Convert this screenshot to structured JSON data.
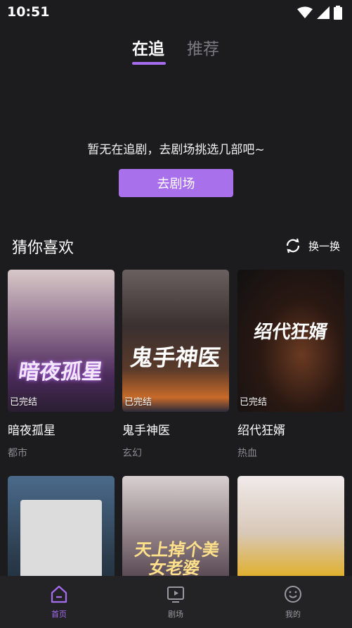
{
  "status_bar": {
    "time": "10:51"
  },
  "top_tabs": [
    {
      "label": "在追",
      "active": true
    },
    {
      "label": "推荐",
      "active": false
    }
  ],
  "empty_state": {
    "message": "暂无在追剧，去剧场挑选几部吧~",
    "button_label": "去剧场"
  },
  "recommend": {
    "title": "猜你喜欢",
    "refresh_label": "换一换",
    "cards": [
      {
        "title": "暗夜孤星",
        "genre": "都市",
        "badge": "已完结",
        "cover_text": "暗夜孤星",
        "cover_color": "#6b4b8a"
      },
      {
        "title": "鬼手神医",
        "genre": "玄幻",
        "badge": "已完结",
        "cover_text": "鬼手神医",
        "cover_color": "#4a3a3a"
      },
      {
        "title": "绍代狂婿",
        "genre": "热血",
        "badge": "已完结",
        "cover_text": "绍代狂婿",
        "cover_color": "#1a1412"
      },
      {
        "title": "",
        "genre": "",
        "badge": "",
        "cover_text": "",
        "cover_color": "#3a4f66"
      },
      {
        "title": "",
        "genre": "",
        "badge": "",
        "cover_text": "天上掉个美女老婆",
        "cover_color": "#5a3a55"
      },
      {
        "title": "",
        "genre": "",
        "badge": "",
        "cover_text": "",
        "cover_color": "#b89a5a"
      }
    ]
  },
  "bottom_nav": [
    {
      "label": "首页",
      "icon": "home-icon",
      "active": true
    },
    {
      "label": "剧场",
      "icon": "play-screen-icon",
      "active": false
    },
    {
      "label": "我的",
      "icon": "smile-face-icon",
      "active": false
    }
  ],
  "colors": {
    "accent": "#a56cf0",
    "background": "#1c1c1e",
    "nav_background": "#232325"
  }
}
